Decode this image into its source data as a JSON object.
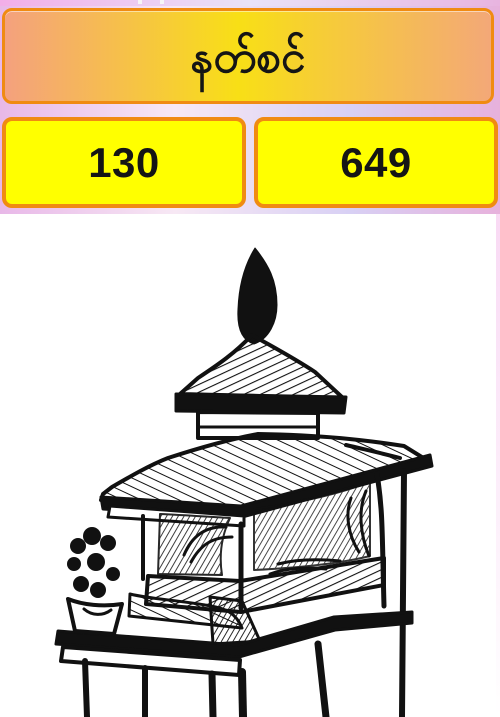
{
  "header": {
    "title": "နတ်စင်"
  },
  "numbers": {
    "left": "130",
    "right": "649"
  },
  "colors": {
    "card_border": "#f08b12",
    "number_card_fill": "#ffff00",
    "title_gradient_left": "#f4a17e",
    "title_gradient_center": "#f8df16",
    "title_gradient_right": "#f3a878",
    "panel_background": "#e8b8e8",
    "ink": "#111111"
  },
  "image": {
    "icon": "spirit-shrine-illustration-icon"
  }
}
